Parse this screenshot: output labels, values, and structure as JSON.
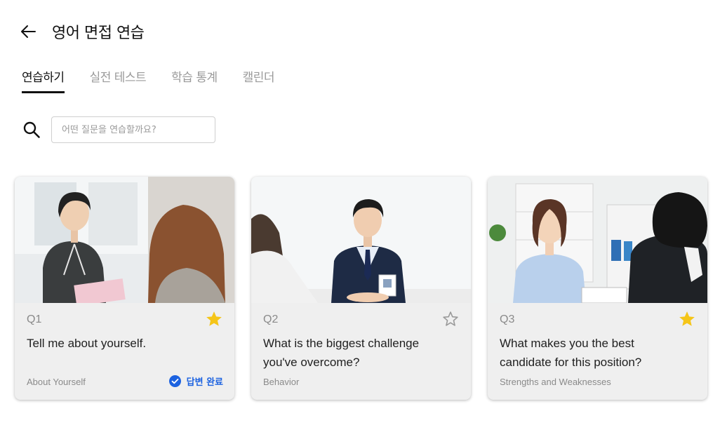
{
  "header": {
    "title": "영어 면접 연습",
    "back_icon": "arrow-left-icon"
  },
  "tabs": [
    {
      "label": "연습하기",
      "active": true
    },
    {
      "label": "실전 테스트",
      "active": false
    },
    {
      "label": "학습 통계",
      "active": false
    },
    {
      "label": "캘린더",
      "active": false
    }
  ],
  "search": {
    "placeholder": "어떤 질문을 연습할까요?",
    "value": "",
    "icon": "search-icon"
  },
  "cards": [
    {
      "number": "Q1",
      "question": "Tell me about yourself.",
      "category": "About Yourself",
      "starred": true,
      "answered": true,
      "answered_label": "답변 완료"
    },
    {
      "number": "Q2",
      "question": "What is the biggest challenge you've overcome?",
      "category": "Behavior",
      "starred": false,
      "answered": false
    },
    {
      "number": "Q3",
      "question": "What makes you the best candidate for this position?",
      "category": "Strengths and Weaknesses",
      "starred": true,
      "answered": false
    }
  ],
  "colors": {
    "star_filled": "#F5C518",
    "star_outline": "#9a9a9a",
    "answered": "#1C62E0",
    "card_bg": "#EFEFEF",
    "tab_active": "#111111",
    "tab_inactive": "#9A9A9A"
  }
}
